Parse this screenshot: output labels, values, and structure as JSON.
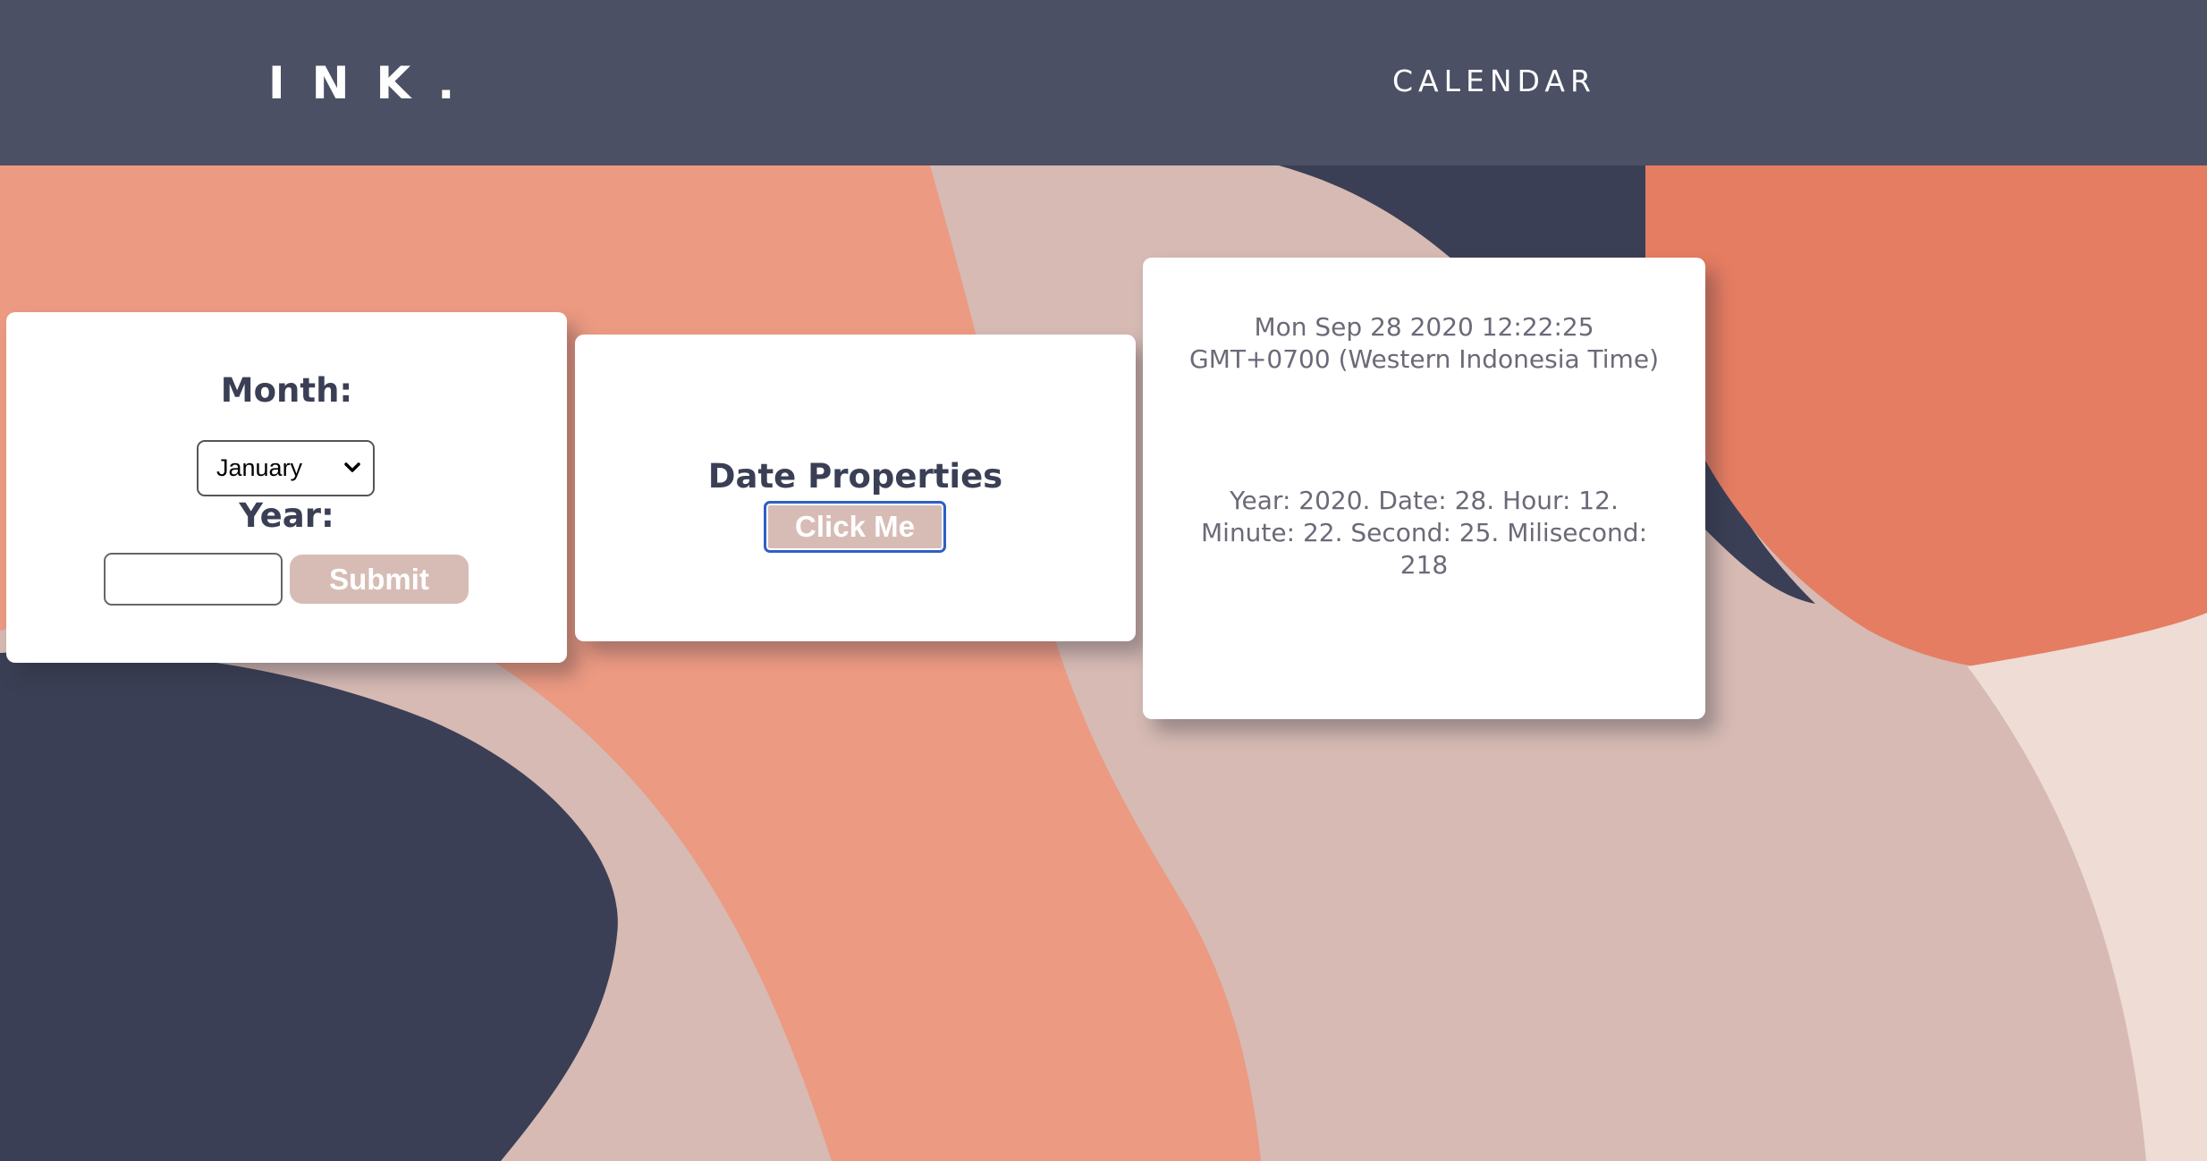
{
  "header": {
    "logo": "INK.",
    "nav_calendar": "CALENDAR"
  },
  "form_card": {
    "month_label": "Month:",
    "month_selected": "January",
    "year_label": "Year:",
    "year_value": "",
    "submit_label": "Submit"
  },
  "props_card": {
    "title": "Date Properties",
    "button_label": "Click Me"
  },
  "info_card": {
    "date_string": "Mon Sep 28 2020 12:22:25 GMT+0700 (Western Indonesia Time)",
    "properties_string": "Year: 2020. Date: 28. Hour: 12. Minute: 22. Second: 25. Milisecond: 218"
  },
  "colors": {
    "header_bg": "#4b5064",
    "navy": "#3b3f55",
    "salmon": "#ec9a82",
    "coral": "#e57d62",
    "blush": "#d6bab3",
    "button_bg": "#d7bcb6",
    "focus_ring": "#2f5fc4"
  },
  "icons": {
    "month_dropdown": "chevron-down-icon"
  }
}
